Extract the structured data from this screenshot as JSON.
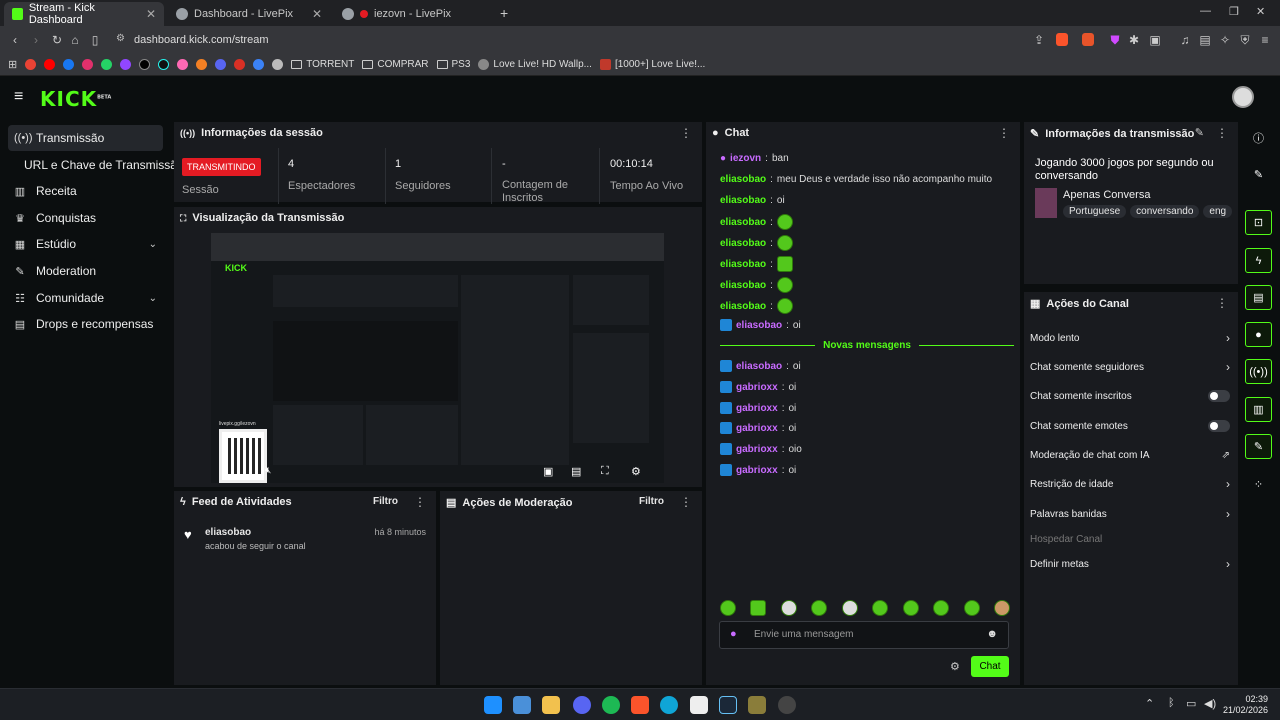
{
  "browser": {
    "tabs": [
      {
        "title": "Stream - Kick Dashboard",
        "active": true,
        "favicon_color": "#53fc18"
      },
      {
        "title": "Dashboard - LivePix",
        "active": false,
        "favicon_color": "#9aa0a6"
      },
      {
        "title": "iezovn - LivePix",
        "active": false,
        "favicon_color": "#9aa0a6"
      }
    ],
    "url": "dashboard.kick.com/stream",
    "bookmarks": [
      "TORRENT",
      "COMPRAR",
      "PS3",
      "Love Live! HD Wallp...",
      "[1000+] Love Live!..."
    ]
  },
  "sidebar": {
    "items": [
      {
        "label": "Transmissão",
        "icon": "broadcast-icon",
        "active": true
      },
      {
        "label": "URL e Chave de Transmissão",
        "icon": ""
      },
      {
        "label": "Receita",
        "icon": "chart-icon"
      },
      {
        "label": "Conquistas",
        "icon": "trophy-icon"
      },
      {
        "label": "Estúdio",
        "icon": "studio-icon",
        "expandable": true
      },
      {
        "label": "Moderation",
        "icon": "wrench-icon"
      },
      {
        "label": "Comunidade",
        "icon": "community-icon",
        "expandable": true
      },
      {
        "label": "Drops e recompensas",
        "icon": "gift-icon"
      }
    ]
  },
  "session": {
    "title": "Informações da sessão",
    "badge": "TRANSMITINDO",
    "stats": [
      {
        "label": "Sessão",
        "value": ""
      },
      {
        "label": "Espectadores",
        "value": "4"
      },
      {
        "label": "Seguidores",
        "value": "1"
      },
      {
        "label": "Contagem de Inscritos",
        "value": "-"
      },
      {
        "label": "Tempo Ao Vivo",
        "value": "00:10:14"
      }
    ]
  },
  "preview": {
    "title": "Visualização da Transmissão",
    "qr_caption": "livepix.gg/iezovn"
  },
  "activity": {
    "title": "Feed de Atividades",
    "filter": "Filtro",
    "items": [
      {
        "user": "eliasobao",
        "action": "acabou de seguir o canal",
        "time": "há 8 minutos"
      }
    ]
  },
  "moderation": {
    "title": "Ações de Moderação",
    "filter": "Filtro"
  },
  "chat": {
    "title": "Chat",
    "messages": [
      {
        "user": "iezovn",
        "text": "ban",
        "color": "purple",
        "badge": "mic"
      },
      {
        "user": "eliasobao",
        "text": "meu Deus e verdade isso não acompanho muito"
      },
      {
        "user": "eliasobao",
        "text": "oi"
      },
      {
        "user": "eliasobao",
        "text": "",
        "emote": true
      },
      {
        "user": "eliasobao",
        "text": "",
        "emote": true
      },
      {
        "user": "eliasobao",
        "text": "",
        "emote": true
      },
      {
        "user": "eliasobao",
        "text": "",
        "emote": true
      },
      {
        "user": "eliasobao",
        "text": "",
        "emote": true
      },
      {
        "user": "eliasobao",
        "text": "oi",
        "badge": "sword"
      }
    ],
    "divider": "Novas mensagens",
    "new_messages": [
      {
        "user": "eliasobao",
        "text": "oi"
      },
      {
        "user": "gabrioxx",
        "text": "oi"
      },
      {
        "user": "gabrioxx",
        "text": "oi"
      },
      {
        "user": "gabrioxx",
        "text": "oi"
      },
      {
        "user": "gabrioxx",
        "text": "oio"
      },
      {
        "user": "gabrioxx",
        "text": "oi"
      }
    ],
    "input_placeholder": "Envie uma mensagem",
    "send_label": "Chat"
  },
  "stream_info": {
    "title": "Informações da transmissão",
    "stream_title": "Jogando 3000 jogos por segundo ou conversando",
    "category": "Apenas Conversa",
    "tags": [
      "Portuguese",
      "conversando",
      "eng"
    ]
  },
  "channel_actions": {
    "title": "Ações do Canal",
    "items": [
      {
        "label": "Modo lento",
        "control": "arrow"
      },
      {
        "label": "Chat somente seguidores",
        "control": "arrow"
      },
      {
        "label": "Chat somente inscritos",
        "control": "toggle"
      },
      {
        "label": "Chat somente emotes",
        "control": "toggle"
      },
      {
        "label": "Moderação de chat com IA",
        "control": "external"
      },
      {
        "label": "Restrição de idade",
        "control": "arrow"
      },
      {
        "label": "Palavras banidas",
        "control": "arrow"
      },
      {
        "label": "Hospedar Canal",
        "control": "none",
        "disabled": true
      },
      {
        "label": "Definir metas",
        "control": "arrow"
      }
    ]
  },
  "taskbar": {
    "time": "02:39",
    "date": "21/02/2026"
  },
  "colors": {
    "accent": "#53fc18",
    "live": "#e41b23",
    "panel": "#191b1f",
    "bg": "#0b0e0f"
  }
}
